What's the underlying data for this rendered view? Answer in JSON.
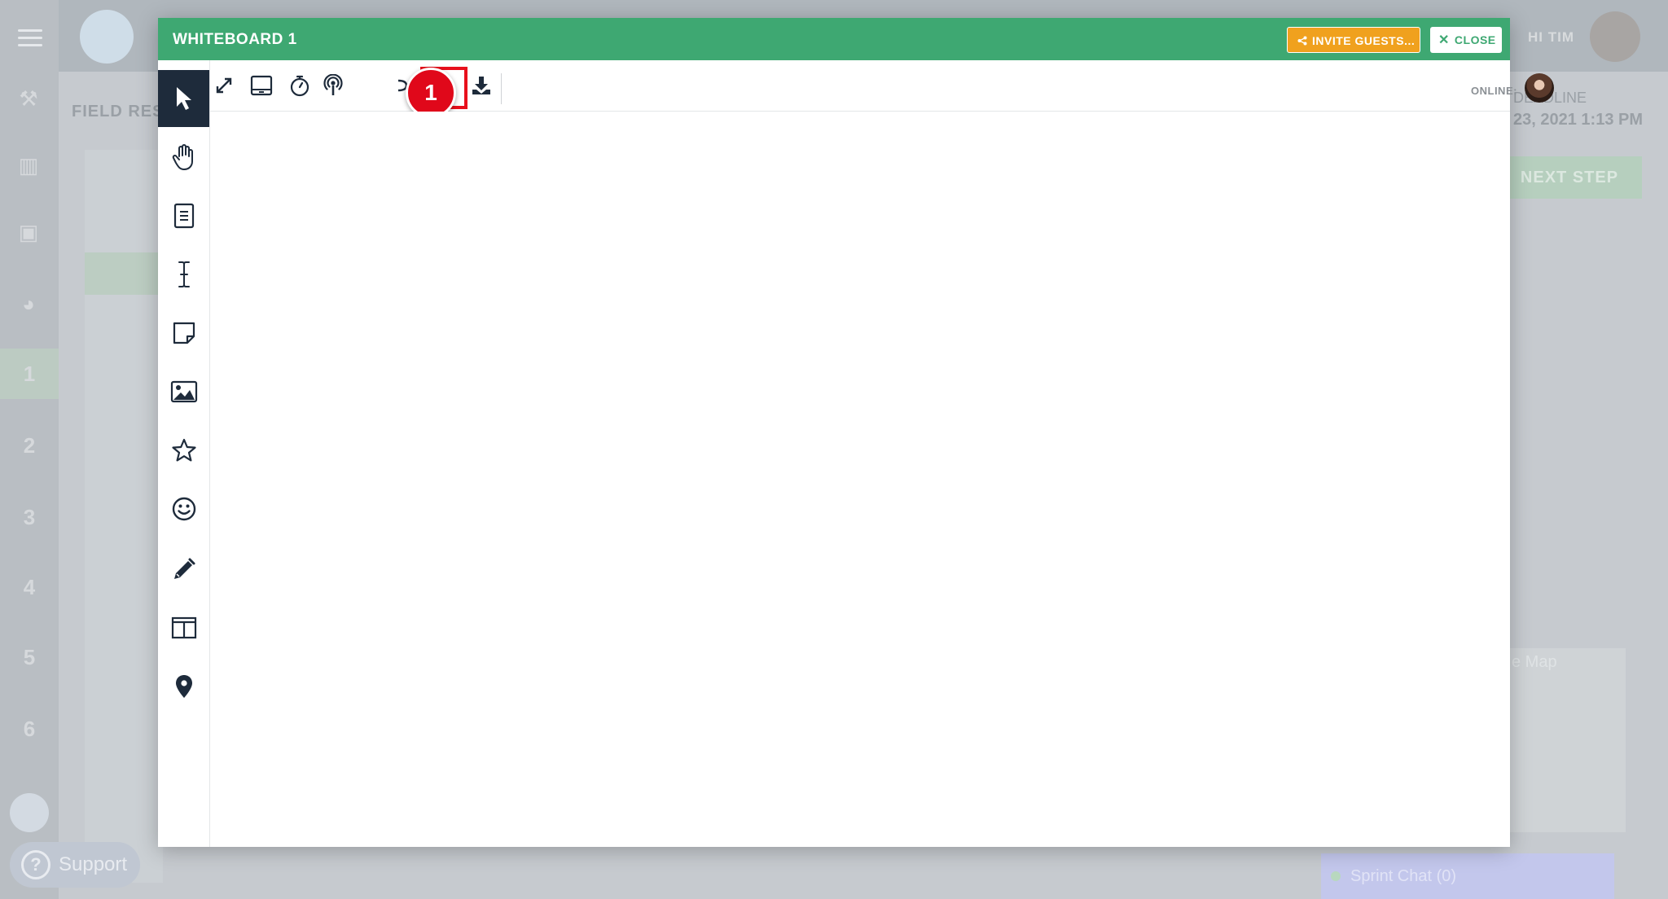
{
  "background_app": {
    "page_title": "FIELD RES",
    "greeting": "HI TIM",
    "deadline_label": "DEADLINE",
    "deadline_date": "23, 2021 1:13 PM",
    "next_step_label": "NEXT STEP",
    "map_label": "e Map",
    "steps": [
      "1",
      "2",
      "3",
      "4",
      "5",
      "6"
    ],
    "support_label": "Support",
    "chat_label": "Sprint Chat (0)"
  },
  "modal": {
    "title": "WHITEBOARD 1",
    "invite_label": "INVITE GUESTS...",
    "close_label": "CLOSE",
    "online_label": "ONLINE:"
  },
  "annotation": {
    "step_number": "1",
    "highlight_color": "#e8101c"
  },
  "colors": {
    "header_green": "#3ea872",
    "invite_orange": "#f0a11e",
    "active_tool_bg": "#1e2b3b"
  },
  "toolbar_icons": [
    "fullscreen-icon",
    "tablet-icon",
    "timer-icon",
    "broadcast-icon",
    "redo-icon",
    "zoom-fit-icon",
    "download-icon"
  ],
  "side_tools": [
    "select-pointer-icon",
    "hand-pan-icon",
    "document-icon",
    "text-cursor-icon",
    "sticky-note-icon",
    "image-icon",
    "star-icon",
    "smiley-icon",
    "pencil-icon",
    "columns-icon",
    "map-pin-icon"
  ]
}
